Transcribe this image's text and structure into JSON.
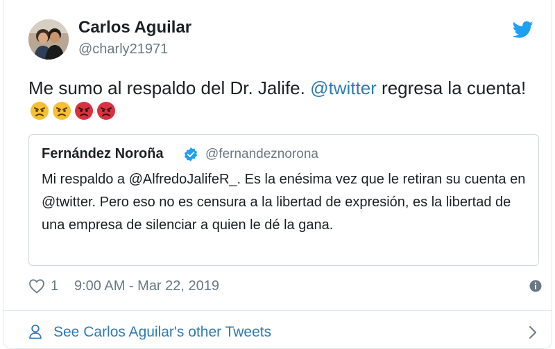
{
  "author": {
    "name": "Carlos Aguilar",
    "handle": "@charly21971"
  },
  "tweet": {
    "text_before": "Me sumo al respaldo del Dr. Jalife. ",
    "mention": "@twitter",
    "text_after": " regresa la cuenta!",
    "emojis": [
      "angry-face",
      "angry-face",
      "pouting-face",
      "pouting-face"
    ]
  },
  "quoted": {
    "name": "Fernández Noroña",
    "handle": "@fernandeznorona",
    "text": "Mi respaldo a @AlfredoJalifeR_. Es la enésima vez que le retiran su cuenta en @twitter. Pero eso no es censura a la libertad de expresión, es la libertad de una empresa de silenciar a quien le dé la gana."
  },
  "footer": {
    "likes": "1",
    "timestamp": "9:00 AM - Mar 22, 2019"
  },
  "more_tweets": {
    "label": "See Carlos Aguilar's other Tweets"
  },
  "colors": {
    "link": "#2b7bb9",
    "twitter_blue": "#1da1f2",
    "muted": "#697882"
  },
  "icons": [
    "twitter-bird-icon",
    "verified-badge-icon",
    "heart-icon",
    "info-icon",
    "person-icon",
    "chevron-right-icon"
  ]
}
